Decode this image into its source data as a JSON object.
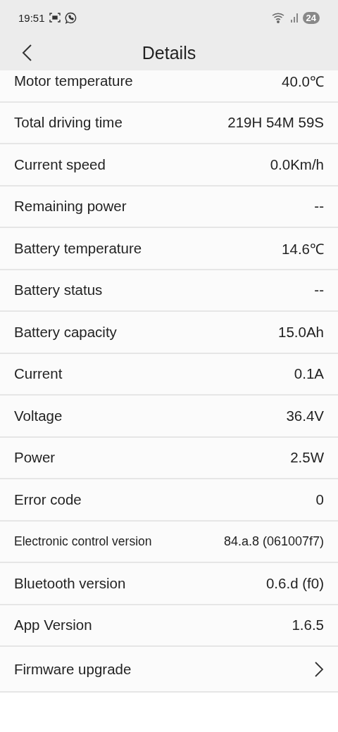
{
  "status_bar": {
    "time": "19:51",
    "battery": "24"
  },
  "header": {
    "title": "Details"
  },
  "rows": [
    {
      "kind": "value",
      "label": "Motor temperature",
      "value": "40.0℃"
    },
    {
      "kind": "value",
      "label": "Total driving time",
      "value": "219H 54M 59S"
    },
    {
      "kind": "value",
      "label": "Current speed",
      "value": "0.0Km/h"
    },
    {
      "kind": "value",
      "label": "Remaining power",
      "value": "--"
    },
    {
      "kind": "value",
      "label": "Battery temperature",
      "value": "14.6℃"
    },
    {
      "kind": "value",
      "label": "Battery status",
      "value": "--"
    },
    {
      "kind": "value",
      "label": "Battery capacity",
      "value": "15.0Ah"
    },
    {
      "kind": "value",
      "label": "Current",
      "value": "0.1A"
    },
    {
      "kind": "value",
      "label": "Voltage",
      "value": "36.4V"
    },
    {
      "kind": "value",
      "label": "Power",
      "value": "2.5W"
    },
    {
      "kind": "value",
      "label": "Error code",
      "value": "0"
    },
    {
      "kind": "small",
      "label": "Electronic control version",
      "value": "84.a.8 (061007f7)"
    },
    {
      "kind": "value",
      "label": "Bluetooth version",
      "value": "0.6.d (f0)"
    },
    {
      "kind": "value",
      "label": "App Version",
      "value": "1.6.5"
    },
    {
      "kind": "link",
      "label": "Firmware upgrade"
    }
  ]
}
